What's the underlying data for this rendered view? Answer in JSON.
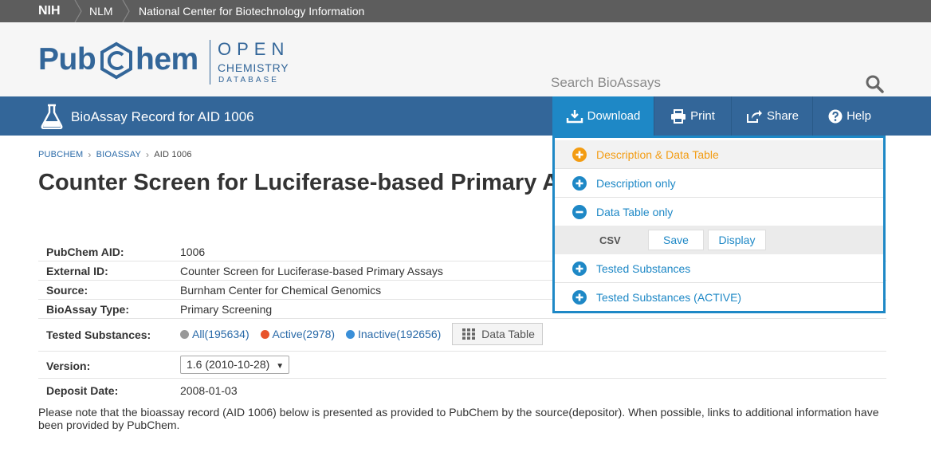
{
  "topbar": {
    "nih": "NIH",
    "nlm": "NLM",
    "ncbi": "National Center for Biotechnology Information"
  },
  "logo": {
    "word_left": "Pub",
    "word_right": "hem",
    "open": "OPEN",
    "chemistry": "CHEMISTRY",
    "database": "DATABASE"
  },
  "search": {
    "placeholder": "Search BioAssays"
  },
  "bluebar": {
    "title": "BioAssay Record for AID 1006"
  },
  "nav": {
    "download": "Download",
    "print": "Print",
    "share": "Share",
    "help": "Help"
  },
  "breadcrumb": {
    "pubchem": "PUBCHEM",
    "bioassay": "BIOASSAY",
    "current": "AID 1006"
  },
  "page_title": "Counter Screen for Luciferase-based Primary Assays",
  "info": {
    "aid_label": "PubChem AID:",
    "aid_value": "1006",
    "external_label": "External ID:",
    "external_value": "Counter Screen for Luciferase-based Primary Assays",
    "source_label": "Source:",
    "source_value": "Burnham Center for Chemical Genomics",
    "type_label": "BioAssay Type:",
    "type_value": "Primary Screening",
    "tested_label": "Tested Substances:",
    "all": "All(195634)",
    "active": "Active(2978)",
    "inactive": "Inactive(192656)",
    "data_table": "Data Table",
    "version_label": "Version:",
    "version_value": "1.6 (2010-10-28)",
    "deposit_label": "Deposit Date:",
    "deposit_value": "2008-01-03"
  },
  "note": "Please note that the bioassay record (AID 1006) below is presented as provided to PubChem by the source(depositor). When possible, links to additional information have been provided by PubChem.",
  "dropdown": {
    "items": [
      {
        "label": "Description & Data Table",
        "icon": "plus-circle-icon"
      },
      {
        "label": "Description only",
        "icon": "plus-circle-icon"
      },
      {
        "label": "Data Table only",
        "icon": "minus-circle-icon"
      },
      {
        "label": "Tested Substances",
        "icon": "plus-circle-icon"
      },
      {
        "label": "Tested Substances (ACTIVE)",
        "icon": "plus-circle-icon"
      }
    ],
    "csv": "CSV",
    "save": "Save",
    "display": "Display"
  },
  "colors": {
    "brand_blue": "#336699",
    "accent": "#1e88c6",
    "highlight": "#f39c12",
    "all_dot": "#999999",
    "active_dot": "#e8532b",
    "inactive_dot": "#3a8fd8"
  }
}
